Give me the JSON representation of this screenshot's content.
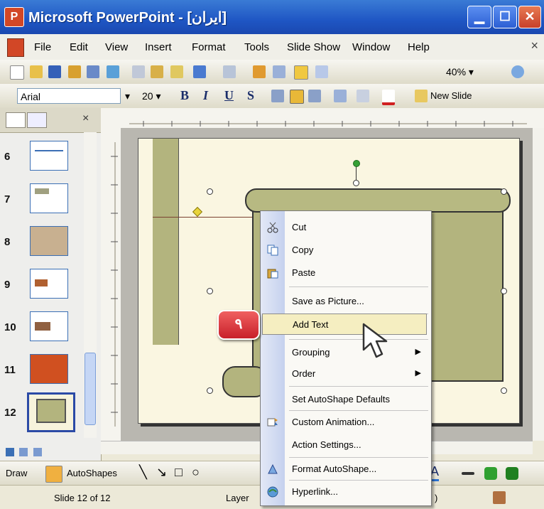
{
  "window": {
    "title": "Microsoft PowerPoint - [ایران]",
    "minimize_icon": "minimize-icon",
    "maximize_icon": "maximize-icon",
    "close_icon": "close-icon"
  },
  "menubar": {
    "items": [
      "File",
      "Edit",
      "View",
      "Insert",
      "Format",
      "Tools",
      "Slide Show",
      "Window",
      "Help"
    ],
    "close_glyph": "×"
  },
  "standard_toolbar": {
    "zoom": "40%"
  },
  "formatting_toolbar": {
    "font_name": "Arial",
    "font_size": "20",
    "bold": "B",
    "italic": "I",
    "underline": "U",
    "shadow": "S",
    "new_slide": "New Slide"
  },
  "slides_pane": {
    "close_glyph": "×",
    "slides": [
      {
        "number": "6"
      },
      {
        "number": "7"
      },
      {
        "number": "8"
      },
      {
        "number": "9"
      },
      {
        "number": "10"
      },
      {
        "number": "11"
      },
      {
        "number": "12",
        "selected": true
      }
    ]
  },
  "context_menu": {
    "items": [
      {
        "label": "Cut",
        "icon": "scissors-icon"
      },
      {
        "label": "Copy",
        "icon": "copy-icon"
      },
      {
        "label": "Paste",
        "icon": "paste-icon"
      },
      {
        "label": "Save as Picture...",
        "icon": ""
      },
      {
        "label": "Add Text",
        "icon": "",
        "highlighted": true
      },
      {
        "label": "Grouping",
        "icon": "",
        "submenu": true
      },
      {
        "label": "Order",
        "icon": "",
        "submenu": true
      },
      {
        "label": "Set AutoShape Defaults",
        "icon": ""
      },
      {
        "label": "Custom Animation...",
        "icon": "animation-icon"
      },
      {
        "label": "Action Settings...",
        "icon": ""
      },
      {
        "label": "Format AutoShape...",
        "icon": "format-shape-icon"
      },
      {
        "label": "Hyperlink...",
        "icon": "hyperlink-icon"
      }
    ],
    "submenu_arrow": "▶"
  },
  "callout": {
    "label": "۹"
  },
  "drawing_toolbar": {
    "draw": "Draw",
    "autoshapes": "AutoShapes"
  },
  "status_bar": {
    "slide_info": "Slide 12 of 12",
    "layout_partial": "Layer"
  }
}
